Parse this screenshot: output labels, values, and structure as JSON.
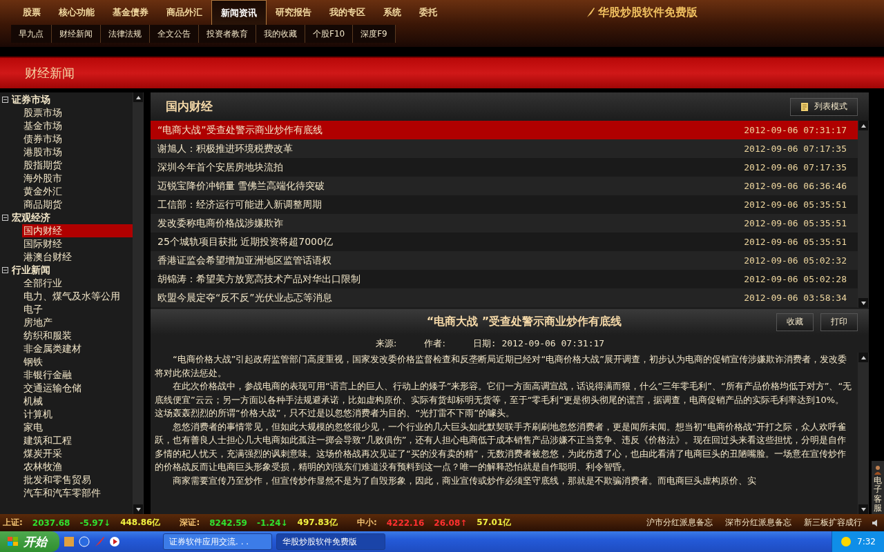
{
  "top_nav": {
    "items": [
      {
        "label": "股票",
        "selected": false
      },
      {
        "label": "核心功能",
        "selected": false
      },
      {
        "label": "基金债券",
        "selected": false
      },
      {
        "label": "商品外汇",
        "selected": false
      },
      {
        "label": "新闻资讯",
        "selected": true
      },
      {
        "label": "研究报告",
        "selected": false
      },
      {
        "label": "我的专区",
        "selected": false
      },
      {
        "label": "系统",
        "selected": false
      },
      {
        "label": "委托",
        "selected": false
      }
    ],
    "brand": "华股炒股软件免费版"
  },
  "sub_nav": [
    "早九点",
    "财经新闻",
    "法律法规",
    "全文公告",
    "投资者教育",
    "我的收藏",
    "个股F10",
    "深度F9"
  ],
  "banner": {
    "title": "财经新闻"
  },
  "sidebar": {
    "tree": [
      {
        "label": "证券市场",
        "expanded": true,
        "children": [
          {
            "label": "股票市场",
            "selected": false
          },
          {
            "label": "基金市场",
            "selected": false
          },
          {
            "label": "债券市场",
            "selected": false
          },
          {
            "label": "港股市场",
            "selected": false
          },
          {
            "label": "股指期货",
            "selected": false
          },
          {
            "label": "海外股市",
            "selected": false
          },
          {
            "label": "黄金外汇",
            "selected": false
          },
          {
            "label": "商品期货",
            "selected": false
          }
        ]
      },
      {
        "label": "宏观经济",
        "expanded": true,
        "children": [
          {
            "label": "国内财经",
            "selected": true
          },
          {
            "label": "国际财经",
            "selected": false
          },
          {
            "label": "港澳台财经",
            "selected": false
          }
        ]
      },
      {
        "label": "行业新闻",
        "expanded": true,
        "children": [
          {
            "label": "全部行业",
            "selected": false
          },
          {
            "label": "电力、煤气及水等公用",
            "selected": false
          },
          {
            "label": "电子",
            "selected": false
          },
          {
            "label": "房地产",
            "selected": false
          },
          {
            "label": "纺织和服装",
            "selected": false
          },
          {
            "label": "非金属类建材",
            "selected": false
          },
          {
            "label": "钢铁",
            "selected": false
          },
          {
            "label": "非银行金融",
            "selected": false
          },
          {
            "label": "交通运输仓储",
            "selected": false
          },
          {
            "label": "机械",
            "selected": false
          },
          {
            "label": "计算机",
            "selected": false
          },
          {
            "label": "家电",
            "selected": false
          },
          {
            "label": "建筑和工程",
            "selected": false
          },
          {
            "label": "煤炭开采",
            "selected": false
          },
          {
            "label": "农林牧渔",
            "selected": false
          },
          {
            "label": "批发和零售贸易",
            "selected": false
          },
          {
            "label": "汽车和汽车零部件",
            "selected": false
          }
        ]
      }
    ]
  },
  "news_list": {
    "title": "国内财经",
    "mode_button": "列表模式",
    "rows": [
      {
        "headline": "“电商大战”受查处警示商业炒作有底线",
        "time": "2012-09-06 07:31:17",
        "selected": true
      },
      {
        "headline": "谢旭人：积极推进环境税费改革",
        "time": "2012-09-06 07:17:35",
        "selected": false
      },
      {
        "headline": "深圳今年首个安居房地块流拍",
        "time": "2012-09-06 07:17:35",
        "selected": false
      },
      {
        "headline": "迈锐宝降价冲销量 雪佛兰高端化待突破",
        "time": "2012-09-06 06:36:46",
        "selected": false
      },
      {
        "headline": "工信部：经济运行可能进入新调整周期",
        "time": "2012-09-06 05:35:51",
        "selected": false
      },
      {
        "headline": "发改委称电商价格战涉嫌欺诈",
        "time": "2012-09-06 05:35:51",
        "selected": false
      },
      {
        "headline": "25个城轨项目获批 近期投资将超7000亿",
        "time": "2012-09-06 05:35:51",
        "selected": false
      },
      {
        "headline": "香港证监会希望增加亚洲地区监管话语权",
        "time": "2012-09-06 05:02:32",
        "selected": false
      },
      {
        "headline": "胡锦涛：希望美方放宽高技术产品对华出口限制",
        "time": "2012-09-06 05:02:28",
        "selected": false
      },
      {
        "headline": "欧盟今晨定夺“反不反”光伏业忐忑等消息",
        "time": "2012-09-06 03:58:34",
        "selected": false
      }
    ]
  },
  "article": {
    "title": "“电商大战 ”受查处警示商业炒作有底线",
    "buttons": [
      "收藏",
      "打印"
    ],
    "source_label": "来源:",
    "author_label": "作者:",
    "date": "日期: 2012-09-06 07:31:17",
    "paragraphs": [
      "“电商价格大战”引起政府监管部门高度重视，国家发改委价格监督检查和反垄断局近期已经对“电商价格大战”展开调查，初步认为电商的促销宣传涉嫌欺诈消费者，发改委将对此依法惩处。",
      "在此次价格战中，参战电商的表现可用“语言上的巨人、行动上的矮子”来形容。它们一方面高调宣战，话说得满而狠，什么“三年零毛利”、“所有产品价格均低于对方”、“无底线便宜”云云；另一方面以各种手法规避承诺，比如虚构原价、实际有货却标明无货等，至于“零毛利”更是彻头彻尾的谎言，据调查，电商促销产品的实际毛利率达到10%。这场轰轰烈烈的所谓“价格大战”，只不过是以忽悠消费者为目的、“光打雷不下雨”的噱头。",
      "忽悠消费者的事情常见，但如此大规模的忽悠很少见，一个行业的几大巨头如此默契联手齐刷刷地忽悠消费者，更是闻所未闻。想当初“电商价格战”开打之际，众人欢呼雀跃，也有善良人士担心几大电商如此孤注一掷会导致“几败俱伤”，还有人担心电商低于成本销售产品涉嫌不正当竞争、违反《价格法》。现在回过头来看这些担忧，分明是自作多情的杞人忧天，充满强烈的讽刺意味。这场价格战再次见证了“买的没有卖的精”，无数消费者被忽悠，为此伤透了心，也由此看清了电商巨头的丑陋嘴脸。一场意在宣传炒作的价格战反而让电商巨头形象受损，精明的刘强东们难道没有预料到这一点？唯一的解释恐怕就是自作聪明、利令智昏。",
      "商家需要宣传乃至炒作，但宣传炒作显然不是为了自毁形象，因此，商业宣传或炒作必须坚守底线，那就是不欺骗消费者。而电商巨头虚构原价、实"
    ]
  },
  "side_tab": "电子客服",
  "status_bar": {
    "quotes": [
      {
        "text": "上证:",
        "kind": "label"
      },
      {
        "text": "2037.68",
        "kind": "down"
      },
      {
        "text": "-5.97↓",
        "kind": "down"
      },
      {
        "text": "448.86亿",
        "kind": "amount"
      },
      {
        "text": "深证:",
        "kind": "label"
      },
      {
        "text": "8242.59",
        "kind": "down"
      },
      {
        "text": "-1.24↓",
        "kind": "down"
      },
      {
        "text": "497.83亿",
        "kind": "amount"
      },
      {
        "text": "中小:",
        "kind": "label"
      },
      {
        "text": "4222.16",
        "kind": "up"
      },
      {
        "text": "26.08↑",
        "kind": "up"
      },
      {
        "text": "57.01亿",
        "kind": "amount"
      }
    ],
    "links": [
      "沪市分红派息备忘",
      "深市分红派息备忘",
      "新三板扩容成行"
    ]
  },
  "taskbar": {
    "start": "开始",
    "tasks": [
      "证券软件应用交流. . .",
      "华股炒股软件免费版"
    ],
    "clock": "7:32"
  }
}
